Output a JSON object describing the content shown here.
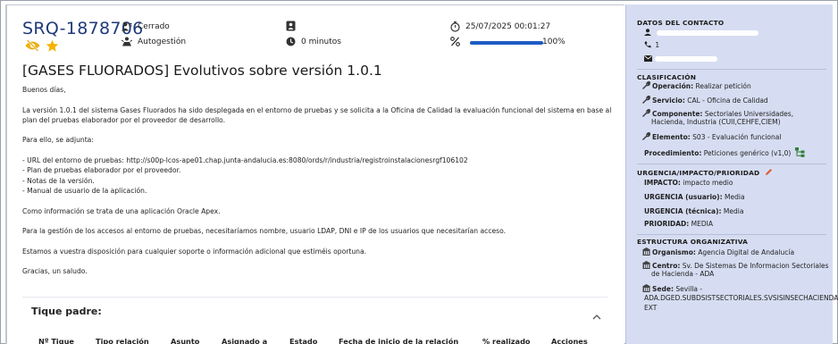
{
  "ticket": {
    "id": "SRQ-1878706",
    "status": "Cerrado",
    "assignment": "Autogestión",
    "elapsed": "0 minutos",
    "datetime": "25/07/2025 00:01:27",
    "progress_label": "100%",
    "progress_value": 1.0,
    "title": "[GASES FLUORADOS] Evolutivos sobre versión 1.0.1",
    "body": [
      "Buenos días,",
      "La versión 1.0.1 del sistema Gases Fluorados ha sido desplegada en el entorno de pruebas y se solicita a la Oficina de Calidad la evaluación funcional del sistema en base al plan del pruebas elaborador por el proveedor de desarrollo.",
      "Para ello, se adjunta:",
      "- URL del entorno de pruebas: http://s00p-lcos-ape01.chap.junta-andalucia.es:8080/ords/r/industria/registroinstalacionesrgf106102\n- Plan de pruebas elaborador por el proveedor.\n- Notas de la versión.\n- Manual de usuario de la aplicación.",
      "Como información se trata de una aplicación Oracle Apex.",
      "Para la gestión de los accesos al entorno de pruebas, necesitaríamos nombre, usuario LDAP, DNI e IP de los usuarios que necesitarían acceso.",
      "Estamos a vuestra disposición para cualquier soporte o información adicional que estiméis oportuna.",
      "Gracias, un saludo."
    ]
  },
  "parent": {
    "title": "Tique padre:",
    "columns": [
      "Nº Tique",
      "Tipo relación",
      "Asunto",
      "Asignado a",
      "Estado",
      "Fecha de inicio de la relación",
      "% realizado",
      "Acciones"
    ]
  },
  "sidebar": {
    "contact": {
      "title": "DATOS DEL CONTACTO",
      "phone": "1"
    },
    "classification": {
      "title": "CLASIFICACIÓN",
      "operacion_label": "Operación:",
      "operacion": "Realizar petición",
      "servicio_label": "Servicio:",
      "servicio": "CAL - Oficina de Calidad",
      "componente_label": "Componente:",
      "componente_1": "Sectoriales Universidades,",
      "componente_2": "Hacienda, Industria (CUII,CEHFE,CIEM)",
      "elemento_label": "Elemento:",
      "elemento": "S03 - Evaluación funcional",
      "procedimiento_label": "Procedimiento:",
      "procedimiento": "Peticiones genérico (v1,0)"
    },
    "priority": {
      "title": "URGENCIA/IMPACTO/PRIORIDAD",
      "impacto_label": "IMPACTO:",
      "impacto": "impacto medio",
      "urg_usuario_label": "URGENCIA (usuario):",
      "urg_usuario": "Media",
      "urg_tecnica_label": "URGENCIA (técnica):",
      "urg_tecnica": "Media",
      "prioridad_label": "PRIORIDAD:",
      "prioridad": "MEDIA"
    },
    "org": {
      "title": "ESTRUCTURA ORGANIZATIVA",
      "organismo_label": "Organismo:",
      "organismo": "Agencia Digital de Andalucía",
      "centro_label": "Centro:",
      "centro_1": "Sv. De Sistemas De Informacion Sectoriales",
      "centro_2": "de Hacienda - ADA",
      "sede_label": "Sede:",
      "sede_1": "Sevilla -",
      "sede_2": "ADA.DGED.SUBDSISTSECTORIALES.SVSISINSECHACIENDA-",
      "sede_3": "EXT"
    }
  },
  "colors": {
    "accent": "#1f3a7a",
    "progress": "#1f5cc4",
    "star": "#f5b301",
    "sidebar_bg": "#d6ddf2",
    "edit": "#e05a2b",
    "tree": "#2e7d32"
  }
}
